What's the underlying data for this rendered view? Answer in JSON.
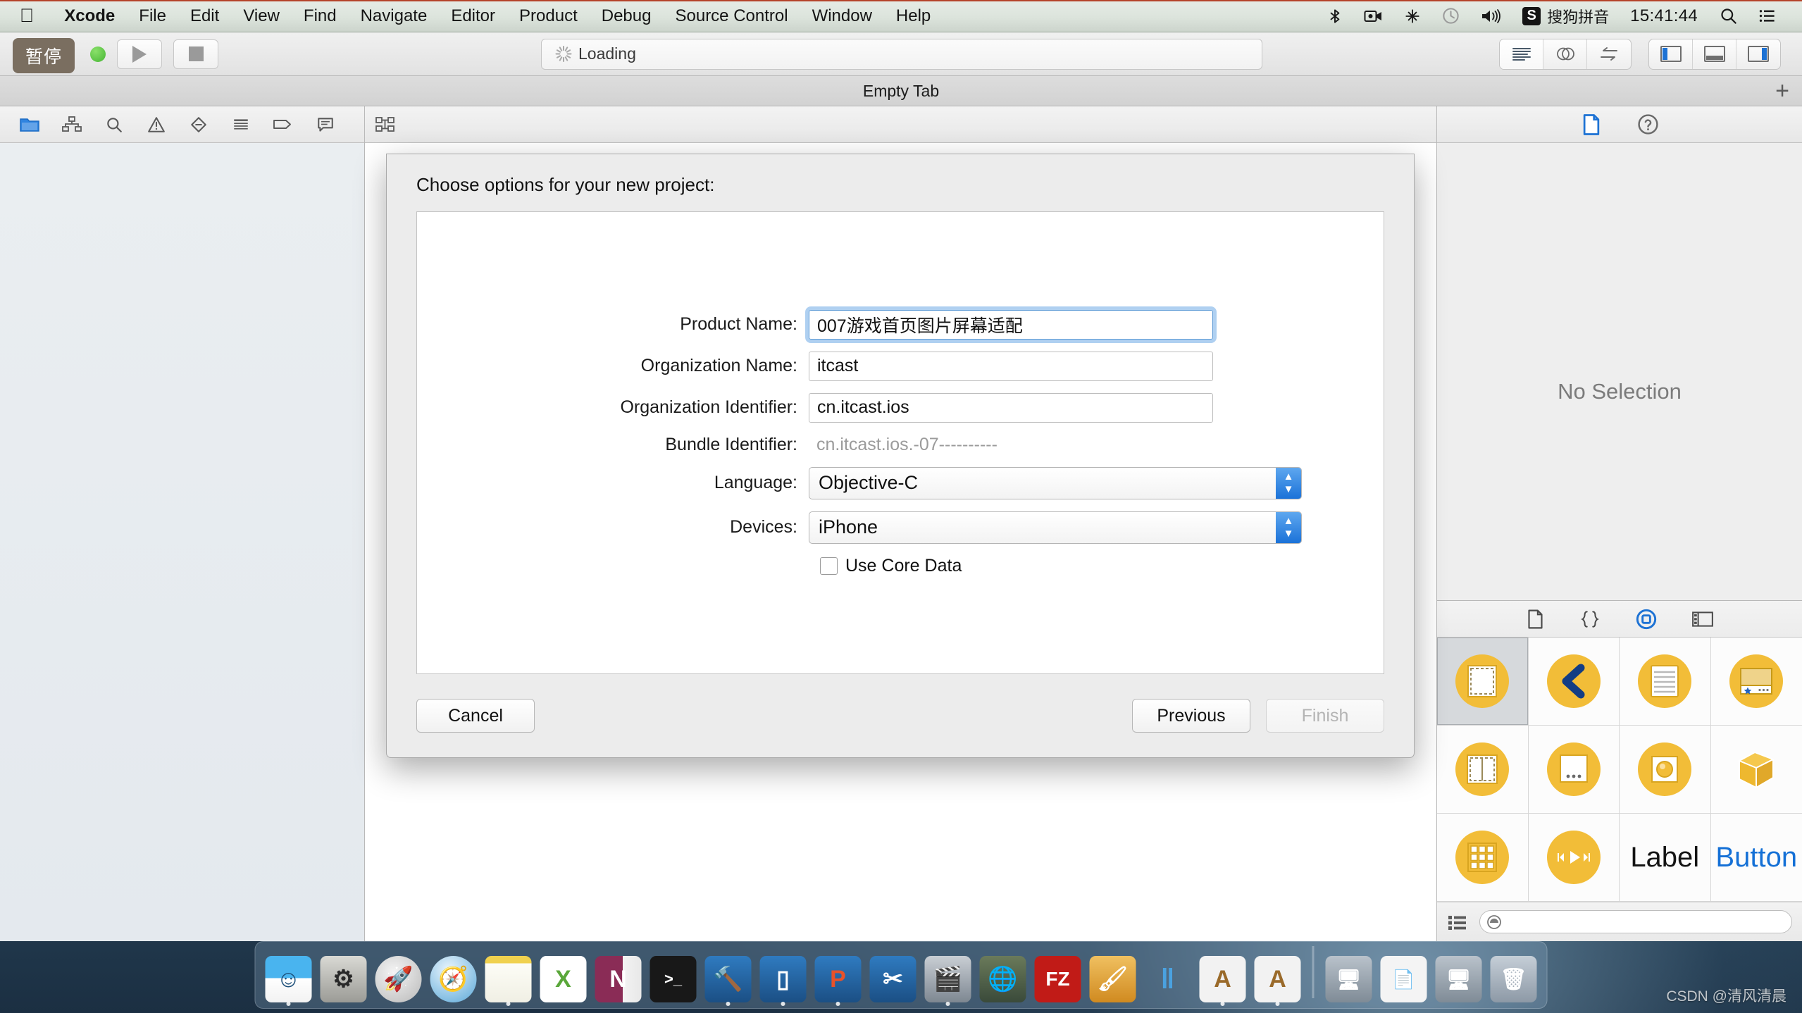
{
  "menubar": {
    "apple_icon": "apple-icon",
    "items": [
      "Xcode",
      "File",
      "Edit",
      "View",
      "Find",
      "Navigate",
      "Editor",
      "Product",
      "Debug",
      "Source Control",
      "Window",
      "Help"
    ],
    "status_icons": [
      "bluetooth-icon",
      "screen-record-icon",
      "dropbox-icon",
      "timemachine-icon",
      "volume-icon"
    ],
    "ime_badge": "S",
    "ime_label": "搜狗拼音",
    "clock": "15:41:44",
    "spotlight_icon": "search-icon",
    "notification_icon": "list-icon"
  },
  "toolbar": {
    "pause_tooltip": "暂停",
    "run_indicator": "green-status-dot",
    "run_icon": "play-icon",
    "stop_icon": "stop-icon",
    "status_text": "Loading",
    "status_spinner": "loading-spinner-icon",
    "editor_modes": [
      "standard-editor-icon",
      "assistant-editor-icon",
      "version-editor-icon"
    ],
    "view_toggles": [
      "navigator-pane-icon",
      "debug-pane-icon",
      "utilities-pane-icon"
    ]
  },
  "tabbar": {
    "tab_label": "Empty Tab",
    "add_tab_icon": "plus-icon"
  },
  "navigator": {
    "icons": [
      "folder-icon",
      "hierarchy-icon",
      "search-icon",
      "warning-icon",
      "issue-icon",
      "test-icon",
      "tag-icon",
      "comment-icon"
    ],
    "selected_index": 0
  },
  "editor_bar": {
    "icon": "breadcrumb-icon"
  },
  "inspector": {
    "tabs": [
      "file-inspector-icon",
      "quick-help-icon"
    ],
    "selected_index": 0,
    "empty_text": "No Selection"
  },
  "library": {
    "tabs": [
      "file-template-library-icon",
      "code-snippet-library-icon",
      "object-library-icon",
      "media-library-icon"
    ],
    "selected_index": 2,
    "items": [
      {
        "name": "view-controller-object",
        "label": "",
        "kind": "dashed-square",
        "selected": true
      },
      {
        "name": "navigation-controller-object",
        "label": "",
        "kind": "chevron-left",
        "selected": false
      },
      {
        "name": "table-view-controller-object",
        "label": "",
        "kind": "lined-page",
        "selected": false
      },
      {
        "name": "tab-bar-controller-object",
        "label": "",
        "kind": "tabbar-card",
        "selected": false
      },
      {
        "name": "split-view-controller-object",
        "label": "",
        "kind": "split-square",
        "selected": false
      },
      {
        "name": "page-view-controller-object",
        "label": "",
        "kind": "dots-card",
        "selected": false
      },
      {
        "name": "glkit-view-controller-object",
        "label": "",
        "kind": "sphere-card",
        "selected": false
      },
      {
        "name": "scene-kit-view-object",
        "label": "",
        "kind": "cube",
        "selected": false
      },
      {
        "name": "collection-view-controller-object",
        "label": "",
        "kind": "grid-nine",
        "selected": false
      },
      {
        "name": "avkit-player-controller-object",
        "label": "",
        "kind": "transport",
        "selected": false
      },
      {
        "name": "label-object",
        "label": "Label",
        "kind": "text",
        "selected": false
      },
      {
        "name": "button-object",
        "label": "Button",
        "kind": "text-blue",
        "selected": false
      }
    ],
    "filter_icons": [
      "list-view-icon",
      "filter-icon"
    ],
    "filter_placeholder": ""
  },
  "sheet": {
    "title": "Choose options for your new project:",
    "fields": [
      {
        "name": "product-name",
        "label": "Product Name:",
        "value": "007游戏首页图片屏幕适配",
        "type": "text",
        "focused": true
      },
      {
        "name": "organization-name",
        "label": "Organization Name:",
        "value": "itcast",
        "type": "text",
        "focused": false
      },
      {
        "name": "organization-identifier",
        "label": "Organization Identifier:",
        "value": "cn.itcast.ios",
        "type": "text",
        "focused": false
      },
      {
        "name": "bundle-identifier",
        "label": "Bundle Identifier:",
        "value": "cn.itcast.ios.-07----------",
        "type": "static",
        "focused": false
      },
      {
        "name": "language",
        "label": "Language:",
        "value": "Objective-C",
        "type": "popup",
        "focused": false
      },
      {
        "name": "devices",
        "label": "Devices:",
        "value": "iPhone",
        "type": "popup",
        "focused": false
      }
    ],
    "checkbox": {
      "label": "Use Core Data",
      "checked": false
    },
    "buttons": {
      "cancel": "Cancel",
      "previous": "Previous",
      "finish": "Finish",
      "finish_disabled": true
    }
  },
  "dock": {
    "items": [
      {
        "name": "dock-finder",
        "glyph": "☺",
        "bg": "#3aa2e8",
        "running": true
      },
      {
        "name": "dock-system-preferences",
        "glyph": "⚙",
        "bg": "#b9b9b4",
        "running": false
      },
      {
        "name": "dock-launchpad",
        "glyph": "🚀",
        "bg": "#d9d9d9",
        "running": false
      },
      {
        "name": "dock-safari",
        "glyph": "🧭",
        "bg": "#cfe3f2",
        "running": false
      },
      {
        "name": "dock-notes",
        "glyph": "",
        "bg": "#f6f1e2",
        "running": true
      },
      {
        "name": "dock-excel",
        "glyph": "X",
        "bg": "#ffffff",
        "running": false
      },
      {
        "name": "dock-onenote",
        "glyph": "N",
        "bg": "#8a2c56",
        "running": false
      },
      {
        "name": "dock-terminal",
        "glyph": ">_",
        "bg": "#1d1d1d",
        "running": false
      },
      {
        "name": "dock-xcode",
        "glyph": "🔨",
        "bg": "#2f6fa8",
        "running": true
      },
      {
        "name": "dock-simulator",
        "glyph": "▯",
        "bg": "#2f6fa8",
        "running": true
      },
      {
        "name": "dock-sketch",
        "glyph": "P",
        "bg": "#2f6fa8",
        "running": true
      },
      {
        "name": "dock-illustrator",
        "glyph": "✂",
        "bg": "#2f6fa8",
        "running": false
      },
      {
        "name": "dock-quicktime",
        "glyph": "🎬",
        "bg": "#8d99a6",
        "running": false
      },
      {
        "name": "dock-fileshare",
        "glyph": "🌐",
        "bg": "#4a5664",
        "running": true
      },
      {
        "name": "dock-filezilla",
        "glyph": "FZ",
        "bg": "#c11b17",
        "running": false
      },
      {
        "name": "dock-paint",
        "glyph": "🖌",
        "bg": "#e8a63a",
        "running": false
      },
      {
        "name": "dock-pages",
        "glyph": "‖",
        "bg": "#3a8ccf",
        "running": false
      },
      {
        "name": "dock-textedit-1",
        "glyph": "A",
        "bg": "#f2f2f2",
        "running": true
      },
      {
        "name": "dock-textedit-2",
        "glyph": "A",
        "bg": "#f2f2f2",
        "running": true
      }
    ],
    "stack_items": [
      {
        "name": "dock-stack-screenshot-1",
        "glyph": "🖥",
        "bg": "#9aa7b4"
      },
      {
        "name": "dock-stack-document",
        "glyph": "📄",
        "bg": "#f4f4f4"
      },
      {
        "name": "dock-stack-screenshot-2",
        "glyph": "🖥",
        "bg": "#9aa7b4"
      },
      {
        "name": "dock-trash",
        "glyph": "🗑",
        "bg": "#aab6c2"
      }
    ]
  },
  "watermark": "CSDN @清风清晨"
}
